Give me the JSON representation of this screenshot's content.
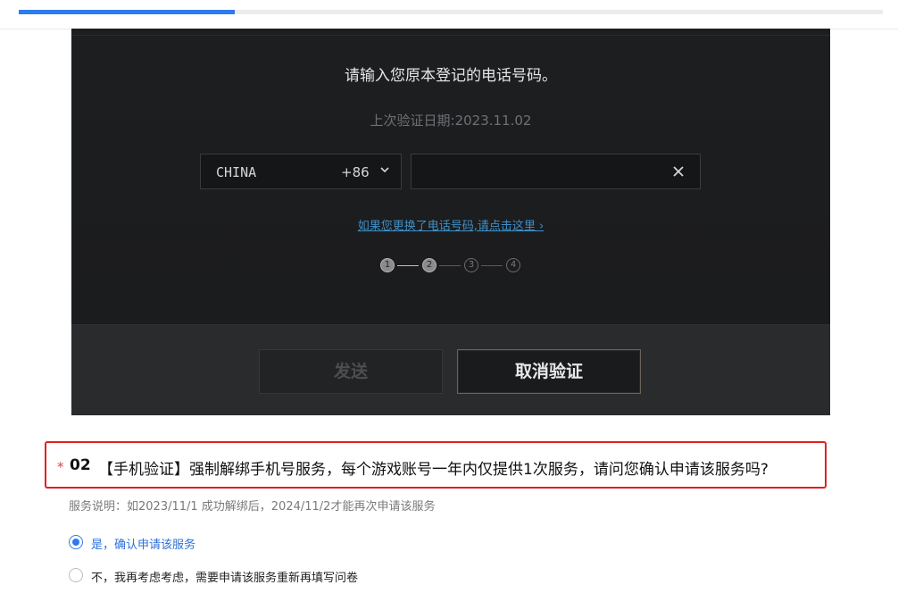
{
  "progress": {
    "fraction": 0.25
  },
  "screenshot": {
    "prompt": "请输入您原本登记的电话号码。",
    "last_verified": "上次验证日期:2023.11.02",
    "country": {
      "name": "CHINA",
      "code": "+86"
    },
    "phone": {
      "value": "",
      "placeholder": ""
    },
    "change_link": "如果您更换了电话号码,请点击这里 ›",
    "steps": [
      "1",
      "2",
      "3",
      "4"
    ],
    "current_step": 2,
    "send_button": "发送",
    "cancel_button": "取消验证"
  },
  "question": {
    "required_mark": "*",
    "number": "02",
    "text": "【手机验证】强制解绑手机号服务，每个游戏账号一年内仅提供1次服务，请问您确认申请该服务吗?",
    "description": "服务说明：如2023/11/1 成功解绑后，2024/11/2才能再次申请该服务",
    "options": [
      {
        "label": "是，确认申请该服务",
        "selected": true
      },
      {
        "label": "不，我再考虑考虑，需要申请该服务重新再填写问卷",
        "selected": false
      }
    ]
  },
  "colors": {
    "accent": "#2e7af0",
    "highlight": "#e02020",
    "dark_bg": "#1e1f21"
  }
}
